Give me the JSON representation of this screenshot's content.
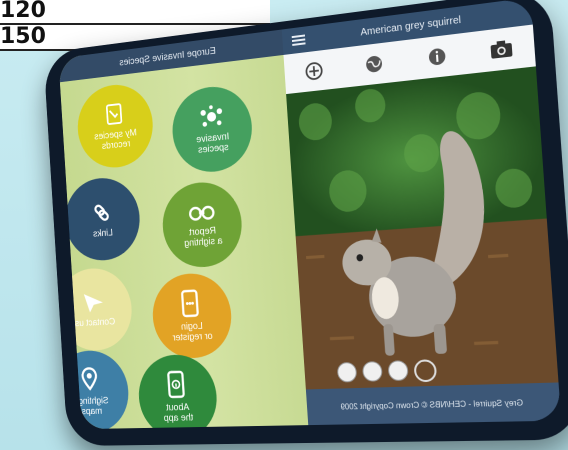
{
  "table": {
    "rows": [
      "120",
      "150"
    ]
  },
  "left_panel": {
    "header_title": "Europe Invasive Species",
    "tiles": [
      {
        "id": "my-species-records",
        "label": "My species\nrecords",
        "color": "#d8cf1a",
        "icon": "clipboard-check-icon"
      },
      {
        "id": "invasive-species",
        "label": "Invasive\nspecies",
        "color": "#45a05f",
        "icon": "dots-cluster-icon"
      },
      {
        "id": "links",
        "label": "Links",
        "color": "#2d4f6e",
        "icon": "link-icon"
      },
      {
        "id": "report-sighting",
        "label": "Report\na sighting",
        "color": "#6fa336",
        "icon": "binoculars-icon"
      },
      {
        "id": "contact-us",
        "label": "Contact us",
        "color": "#e9e5a0",
        "icon": "paper-plane-icon"
      },
      {
        "id": "login-register",
        "label": "Login\nor register",
        "color": "#e2a325",
        "icon": "phone-login-icon"
      },
      {
        "id": "sightings-maps",
        "label": "Sightings\nmaps",
        "color": "#3e7fa6",
        "icon": "map-pin-icon"
      },
      {
        "id": "about-app",
        "label": "About\nthe app",
        "color": "#2f8a3c",
        "icon": "phone-info-icon"
      }
    ]
  },
  "right_panel": {
    "header_title": "American grey squirrel",
    "tools": [
      "plus-circle-icon",
      "globe-icon",
      "info-icon",
      "camera-icon"
    ],
    "footer_caption": "Grey Squirrel - CEH/NBS © Crown Copyright 2009",
    "carousel": {
      "count": 4,
      "active_index": 3
    }
  }
}
